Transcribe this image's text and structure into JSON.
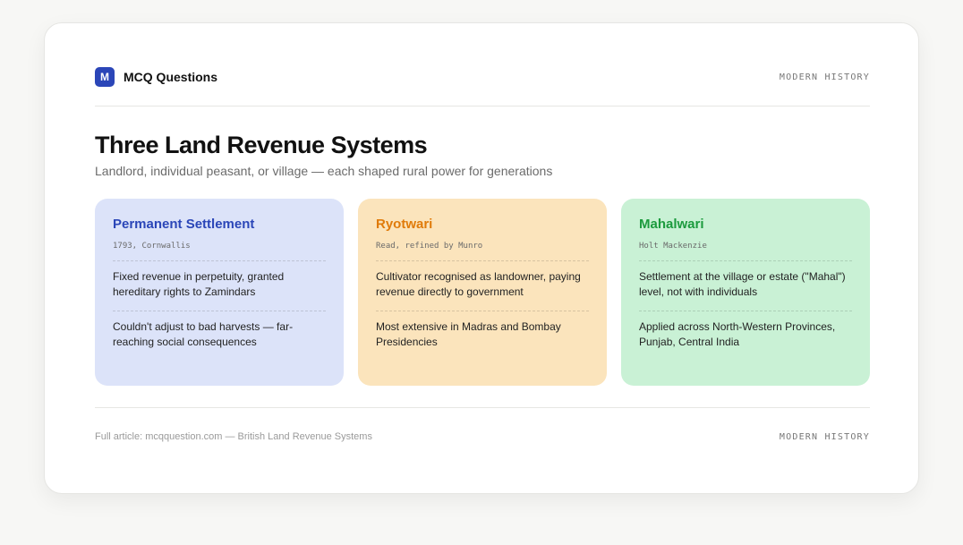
{
  "header": {
    "brand_mark": "M",
    "brand_name": "MCQ Questions",
    "category": "MODERN HISTORY"
  },
  "main": {
    "title": "Three Land Revenue Systems",
    "subtitle": "Landlord, individual peasant, or village — each shaped rural power for generations"
  },
  "systems": [
    {
      "name": "Permanent Settlement",
      "meta": "1793, Cornwallis",
      "point1": "Fixed revenue in perpetuity, granted hereditary rights to Zamindars",
      "point2": "Couldn't adjust to bad harvests — far-reaching social consequences",
      "bg": "#dce3f9",
      "accent": "#2b46b8"
    },
    {
      "name": "Ryotwari",
      "meta": "Read, refined by Munro",
      "point1": "Cultivator recognised as landowner, paying revenue directly to government",
      "point2": "Most extensive in Madras and Bombay Presidencies",
      "bg": "#fbe4bc",
      "accent": "#e07b0a"
    },
    {
      "name": "Mahalwari",
      "meta": "Holt Mackenzie",
      "point1": "Settlement at the village or estate (\"Mahal\") level, not with individuals",
      "point2": "Applied across North-Western Provinces, Punjab, Central India",
      "bg": "#c9f1d5",
      "accent": "#1c9b3e"
    }
  ],
  "footer": {
    "link_text": "Full article: mcqquestion.com — British Land Revenue Systems",
    "category": "MODERN HISTORY"
  }
}
